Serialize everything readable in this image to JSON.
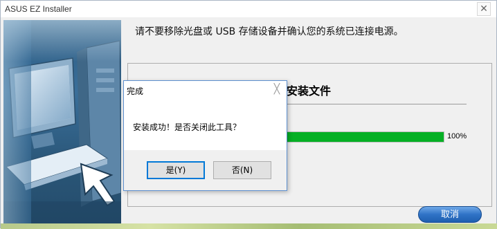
{
  "window": {
    "title": "ASUS EZ Installer",
    "close_symbol": "✕"
  },
  "main": {
    "instruction": "请不要移除光盘或 USB 存储设备并确认您的系统已连接电源。",
    "section_title": "安装文件",
    "progress": {
      "value": 1.0,
      "label": "100%"
    },
    "cancel_label": "取消"
  },
  "dialog": {
    "title": "完成",
    "close_symbol": "╳",
    "message": "安装成功！是否关闭此工具？",
    "yes_label": "是(Y)",
    "no_label": "否(N)"
  },
  "colors": {
    "progress": "#06b025",
    "cancel_button": "#2f73c6",
    "dialog_border": "#5c8fcf",
    "default_button_border": "#0078d7"
  },
  "icons": [
    "computer-illustration",
    "close-icon"
  ]
}
